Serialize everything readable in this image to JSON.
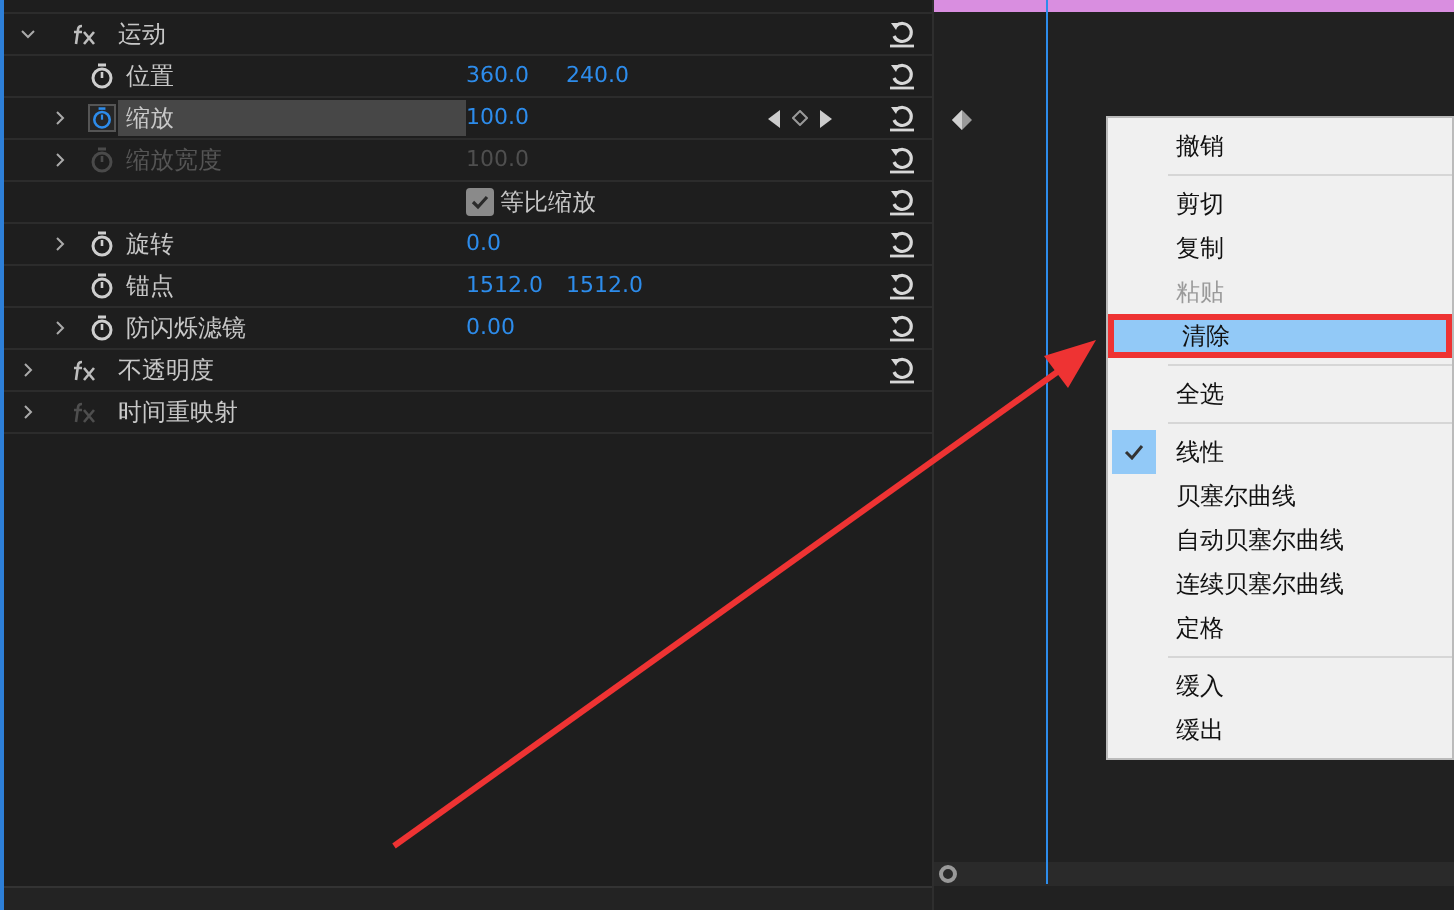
{
  "effects": [
    {
      "kind": "group",
      "label": "运动",
      "expandable": true,
      "expanded": true,
      "fx_enabled": true,
      "reset": true
    },
    {
      "kind": "param",
      "label": "位置",
      "values": [
        "360.0",
        "240.0"
      ],
      "expandable": false,
      "animated": false,
      "disabled": false,
      "selected": false,
      "keyframe_nav": false,
      "keyframe": false,
      "reset": true
    },
    {
      "kind": "param",
      "label": "缩放",
      "values": [
        "100.0"
      ],
      "expandable": true,
      "animated": true,
      "disabled": false,
      "selected": true,
      "keyframe_nav": true,
      "keyframe": true,
      "reset": true
    },
    {
      "kind": "param",
      "label": "缩放宽度",
      "values": [
        "100.0"
      ],
      "expandable": true,
      "animated": false,
      "disabled": true,
      "selected": false,
      "keyframe_nav": false,
      "keyframe": false,
      "reset": true
    },
    {
      "kind": "checkbox",
      "label": "等比缩放",
      "checked": true,
      "reset": true
    },
    {
      "kind": "param",
      "label": "旋转",
      "values": [
        "0.0"
      ],
      "expandable": true,
      "animated": false,
      "disabled": false,
      "selected": false,
      "keyframe_nav": false,
      "keyframe": false,
      "reset": true
    },
    {
      "kind": "param",
      "label": "锚点",
      "values": [
        "1512.0",
        "1512.0"
      ],
      "expandable": false,
      "animated": false,
      "disabled": false,
      "selected": false,
      "keyframe_nav": false,
      "keyframe": false,
      "reset": true
    },
    {
      "kind": "param",
      "label": "防闪烁滤镜",
      "values": [
        "0.00"
      ],
      "expandable": true,
      "animated": false,
      "disabled": false,
      "selected": false,
      "keyframe_nav": false,
      "keyframe": false,
      "reset": true
    },
    {
      "kind": "group",
      "label": "不透明度",
      "expandable": true,
      "expanded": false,
      "fx_enabled": true,
      "reset": true
    },
    {
      "kind": "group",
      "label": "时间重映射",
      "expandable": true,
      "expanded": false,
      "fx_enabled": false,
      "reset": false
    }
  ],
  "context_menu": [
    {
      "kind": "item",
      "label": "撤销",
      "disabled": false,
      "checked": false,
      "highlighted": false
    },
    {
      "kind": "separator"
    },
    {
      "kind": "item",
      "label": "剪切",
      "disabled": false,
      "checked": false,
      "highlighted": false
    },
    {
      "kind": "item",
      "label": "复制",
      "disabled": false,
      "checked": false,
      "highlighted": false
    },
    {
      "kind": "item",
      "label": "粘贴",
      "disabled": true,
      "checked": false,
      "highlighted": false
    },
    {
      "kind": "item",
      "label": "清除",
      "disabled": false,
      "checked": false,
      "highlighted": true
    },
    {
      "kind": "separator"
    },
    {
      "kind": "item",
      "label": "全选",
      "disabled": false,
      "checked": false,
      "highlighted": false
    },
    {
      "kind": "separator"
    },
    {
      "kind": "item",
      "label": "线性",
      "disabled": false,
      "checked": true,
      "highlighted": false
    },
    {
      "kind": "item",
      "label": "贝塞尔曲线",
      "disabled": false,
      "checked": false,
      "highlighted": false
    },
    {
      "kind": "item",
      "label": "自动贝塞尔曲线",
      "disabled": false,
      "checked": false,
      "highlighted": false
    },
    {
      "kind": "item",
      "label": "连续贝塞尔曲线",
      "disabled": false,
      "checked": false,
      "highlighted": false
    },
    {
      "kind": "item",
      "label": "定格",
      "disabled": false,
      "checked": false,
      "highlighted": false
    },
    {
      "kind": "separator"
    },
    {
      "kind": "item",
      "label": "缓入",
      "disabled": false,
      "checked": false,
      "highlighted": false
    },
    {
      "kind": "item",
      "label": "缓出",
      "disabled": false,
      "checked": false,
      "highlighted": false
    }
  ]
}
